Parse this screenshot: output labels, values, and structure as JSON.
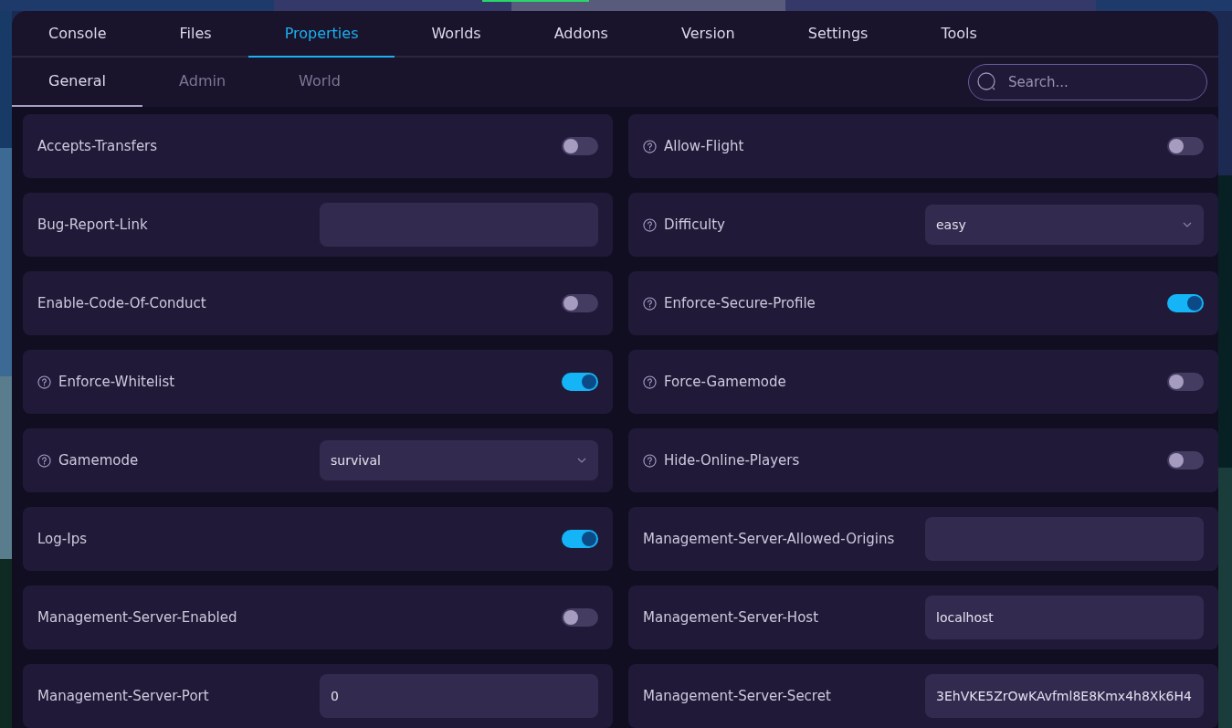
{
  "tabs": [
    {
      "label": "Console",
      "selected": false
    },
    {
      "label": "Files",
      "selected": false
    },
    {
      "label": "Properties",
      "selected": true
    },
    {
      "label": "Worlds",
      "selected": false
    },
    {
      "label": "Addons",
      "selected": false
    },
    {
      "label": "Version",
      "selected": false
    },
    {
      "label": "Settings",
      "selected": false
    },
    {
      "label": "Tools",
      "selected": false
    }
  ],
  "subtabs": [
    {
      "label": "General",
      "selected": true
    },
    {
      "label": "Admin",
      "selected": false
    },
    {
      "label": "World",
      "selected": false
    }
  ],
  "search": {
    "placeholder": "Search..."
  },
  "properties": [
    {
      "label": "Accepts-Transfers",
      "help": false,
      "kind": "toggle",
      "on": false
    },
    {
      "label": "Allow-Flight",
      "help": true,
      "kind": "toggle",
      "on": false
    },
    {
      "label": "Bug-Report-Link",
      "help": false,
      "kind": "text"
    },
    {
      "label": "Difficulty",
      "help": true,
      "kind": "select",
      "value": "easy"
    },
    {
      "label": "Enable-Code-Of-Conduct",
      "help": false,
      "kind": "toggle",
      "on": false
    },
    {
      "label": "Enforce-Secure-Profile",
      "help": true,
      "kind": "toggle",
      "on": true
    },
    {
      "label": "Enforce-Whitelist",
      "help": true,
      "kind": "toggle",
      "on": true
    },
    {
      "label": "Force-Gamemode",
      "help": true,
      "kind": "toggle",
      "on": false
    },
    {
      "label": "Gamemode",
      "help": true,
      "kind": "select",
      "value": "survival"
    },
    {
      "label": "Hide-Online-Players",
      "help": true,
      "kind": "toggle",
      "on": false
    },
    {
      "label": "Log-Ips",
      "help": false,
      "kind": "toggle",
      "on": true
    },
    {
      "label": "Management-Server-Allowed-Origins",
      "help": false,
      "kind": "text"
    },
    {
      "label": "Management-Server-Enabled",
      "help": false,
      "kind": "toggle",
      "on": false
    },
    {
      "label": "Management-Server-Host",
      "help": false,
      "kind": "text",
      "value": "localhost"
    },
    {
      "label": "Management-Server-Port",
      "help": false,
      "kind": "text",
      "value": "0"
    },
    {
      "label": "Management-Server-Secret",
      "help": false,
      "kind": "text",
      "value": "3EhVKE5ZrOwKAvfml8E8Kmx4h8Xk6H4"
    }
  ]
}
